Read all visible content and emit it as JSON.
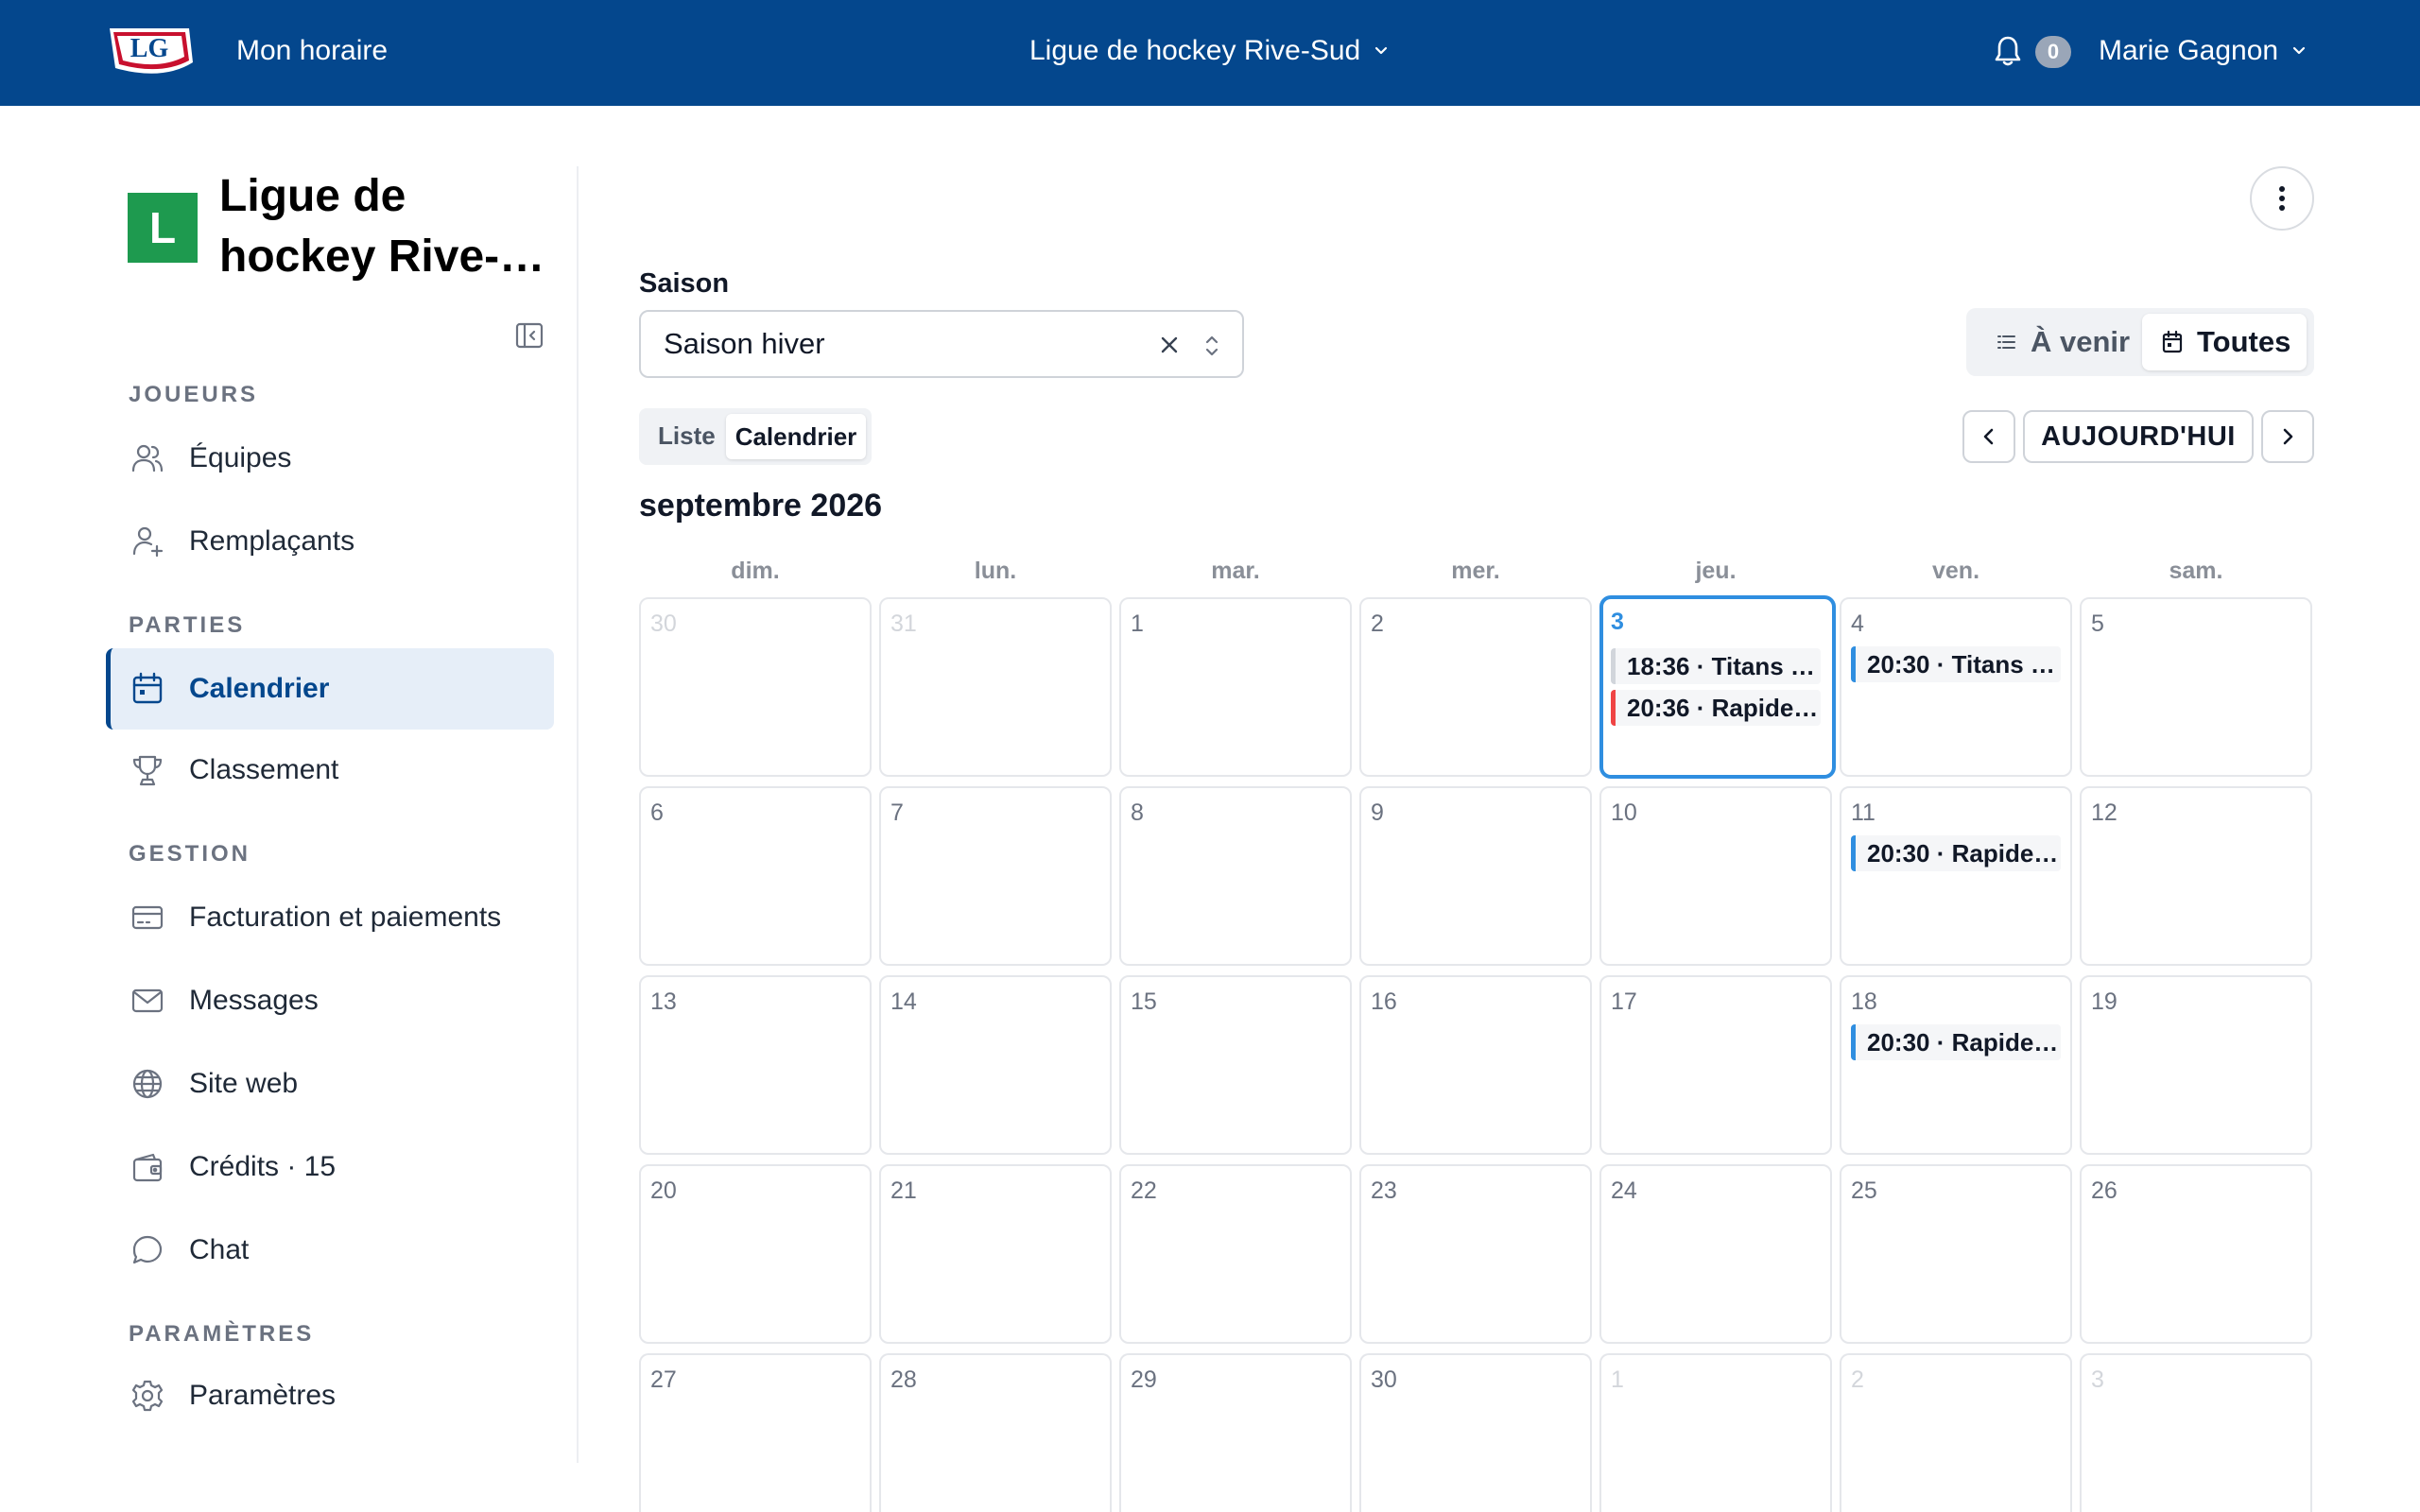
{
  "topbar": {
    "logo_text": "LG",
    "my_schedule": "Mon horaire",
    "league_name": "Ligue de hockey Rive-Sud",
    "notification_count": "0",
    "user_name": "Marie Gagnon"
  },
  "sidebar": {
    "org_initial": "L",
    "org_name_line1": "Ligue de",
    "org_name_line2": "hockey Rive-…",
    "sections": {
      "players": "JOUEURS",
      "games": "PARTIES",
      "management": "GESTION",
      "settings": "PARAMÈTRES"
    },
    "items": {
      "teams": "Équipes",
      "substitutes": "Remplaçants",
      "calendar": "Calendrier",
      "standings": "Classement",
      "billing": "Facturation et paiements",
      "messages": "Messages",
      "website": "Site web",
      "credits": "Crédits · 15",
      "chat": "Chat",
      "settings": "Paramètres"
    }
  },
  "main": {
    "season_label": "Saison",
    "season_value": "Saison hiver",
    "filter": {
      "upcoming": "À venir",
      "all": "Toutes",
      "selected": "all"
    },
    "view": {
      "list": "Liste",
      "calendar": "Calendrier",
      "selected": "calendar"
    },
    "today_button": "AUJOURD'HUI",
    "month_title": "septembre 2026",
    "weekdays": [
      "dim.",
      "lun.",
      "mar.",
      "mer.",
      "jeu.",
      "ven.",
      "sam."
    ]
  },
  "calendar": {
    "days": [
      "30",
      "31",
      "1",
      "2",
      "3",
      "4",
      "5",
      "6",
      "7",
      "8",
      "9",
      "10",
      "11",
      "12",
      "13",
      "14",
      "15",
      "16",
      "17",
      "18",
      "19",
      "20",
      "21",
      "22",
      "23",
      "24",
      "25",
      "26",
      "27",
      "28",
      "29",
      "30",
      "1",
      "2",
      "3"
    ],
    "events": {
      "sep3_a": "18:36 · Titans …",
      "sep3_b": "20:36 · Rapide…",
      "sep4": "20:30 · Titans …",
      "sep11": "20:30 · Rapide…",
      "sep18": "20:30 · Rapide…"
    }
  },
  "colors": {
    "brand_blue": "#04478d",
    "today_blue": "#2f8ee0",
    "org_green": "#1e9a4f",
    "event_red": "#ef4444"
  },
  "icons": {
    "bell": "bell-icon",
    "chevron": "chevron-down-icon",
    "collapse": "sidebar-collapse-icon",
    "teams": "users-icon",
    "substitutes": "user-plus-icon",
    "calendar": "calendar-icon",
    "standings": "trophy-icon",
    "billing": "credit-card-icon",
    "messages": "mail-icon",
    "website": "globe-icon",
    "credits": "wallet-icon",
    "chat": "chat-bubble-icon",
    "settings": "gear-icon",
    "more": "more-vertical-icon",
    "list": "list-icon",
    "clear": "close-icon",
    "caret": "select-caret-icon"
  }
}
